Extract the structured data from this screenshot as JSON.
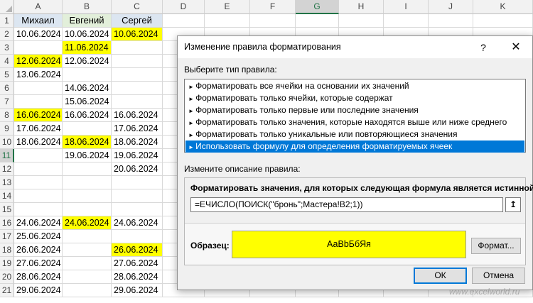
{
  "sheet": {
    "columns": [
      "A",
      "B",
      "C",
      "D",
      "E",
      "F",
      "G",
      "H",
      "I",
      "J",
      "K"
    ],
    "selected_column": "G",
    "selected_row": 11,
    "rows": [
      {
        "n": 1,
        "A": "Михаил",
        "B": "Евгений",
        "C": "Сергей",
        "hl": []
      },
      {
        "n": 2,
        "A": "10.06.2024",
        "B": "10.06.2024",
        "C": "10.06.2024",
        "hl": [
          "C"
        ]
      },
      {
        "n": 3,
        "A": "",
        "B": "11.06.2024",
        "C": "",
        "hl": [
          "B"
        ]
      },
      {
        "n": 4,
        "A": "12.06.2024",
        "B": "12.06.2024",
        "C": "",
        "hl": [
          "A"
        ]
      },
      {
        "n": 5,
        "A": "13.06.2024",
        "B": "",
        "C": "",
        "hl": []
      },
      {
        "n": 6,
        "A": "",
        "B": "14.06.2024",
        "C": "",
        "hl": []
      },
      {
        "n": 7,
        "A": "",
        "B": "15.06.2024",
        "C": "",
        "hl": []
      },
      {
        "n": 8,
        "A": "16.06.2024",
        "B": "16.06.2024",
        "C": "16.06.2024",
        "hl": [
          "A"
        ]
      },
      {
        "n": 9,
        "A": "17.06.2024",
        "B": "",
        "C": "17.06.2024",
        "hl": []
      },
      {
        "n": 10,
        "A": "18.06.2024",
        "B": "18.06.2024",
        "C": "18.06.2024",
        "hl": [
          "B"
        ]
      },
      {
        "n": 11,
        "A": "",
        "B": "19.06.2024",
        "C": "19.06.2024",
        "hl": []
      },
      {
        "n": 12,
        "A": "",
        "B": "",
        "C": "20.06.2024",
        "hl": []
      },
      {
        "n": 13,
        "A": "",
        "B": "",
        "C": "",
        "hl": []
      },
      {
        "n": 14,
        "A": "",
        "B": "",
        "C": "",
        "hl": []
      },
      {
        "n": 15,
        "A": "",
        "B": "",
        "C": "",
        "hl": []
      },
      {
        "n": 16,
        "A": "24.06.2024",
        "B": "24.06.2024",
        "C": "24.06.2024",
        "hl": [
          "B"
        ]
      },
      {
        "n": 17,
        "A": "25.06.2024",
        "B": "",
        "C": "",
        "hl": []
      },
      {
        "n": 18,
        "A": "26.06.2024",
        "B": "",
        "C": "26.06.2024",
        "hl": [
          "C"
        ]
      },
      {
        "n": 19,
        "A": "27.06.2024",
        "B": "",
        "C": "27.06.2024",
        "hl": []
      },
      {
        "n": 20,
        "A": "28.06.2024",
        "B": "",
        "C": "28.06.2024",
        "hl": []
      },
      {
        "n": 21,
        "A": "29.06.2024",
        "B": "",
        "C": "29.06.2024",
        "hl": []
      }
    ],
    "highlight_color": "#ffff00"
  },
  "dialog": {
    "title": "Изменение правила форматирования",
    "help_label": "?",
    "close_label": "✕",
    "rule_type_label": "Выберите тип правила:",
    "rule_types": [
      "Форматировать все ячейки на основании их значений",
      "Форматировать только ячейки, которые содержат",
      "Форматировать только первые или последние значения",
      "Форматировать только значения, которые находятся выше или ниже среднего",
      "Форматировать только уникальные или повторяющиеся значения",
      "Использовать формулу для определения форматируемых ячеек"
    ],
    "selected_rule_index": 5,
    "description_label": "Измените описание правила:",
    "formula_label": "Форматировать значения, для которых следующая формула является истинной:",
    "formula_value": "=ЕЧИСЛО(ПОИСК(\"бронь\";Мастера!B2;1))",
    "collapse_icon": "↥",
    "preview_label": "Образец:",
    "preview_text": "АаВbБбЯя",
    "format_button": "Формат...",
    "ok_button": "ОК",
    "cancel_button": "Отмена",
    "accent_color": "#0078d7"
  },
  "watermark": "www.excelworld.ru"
}
